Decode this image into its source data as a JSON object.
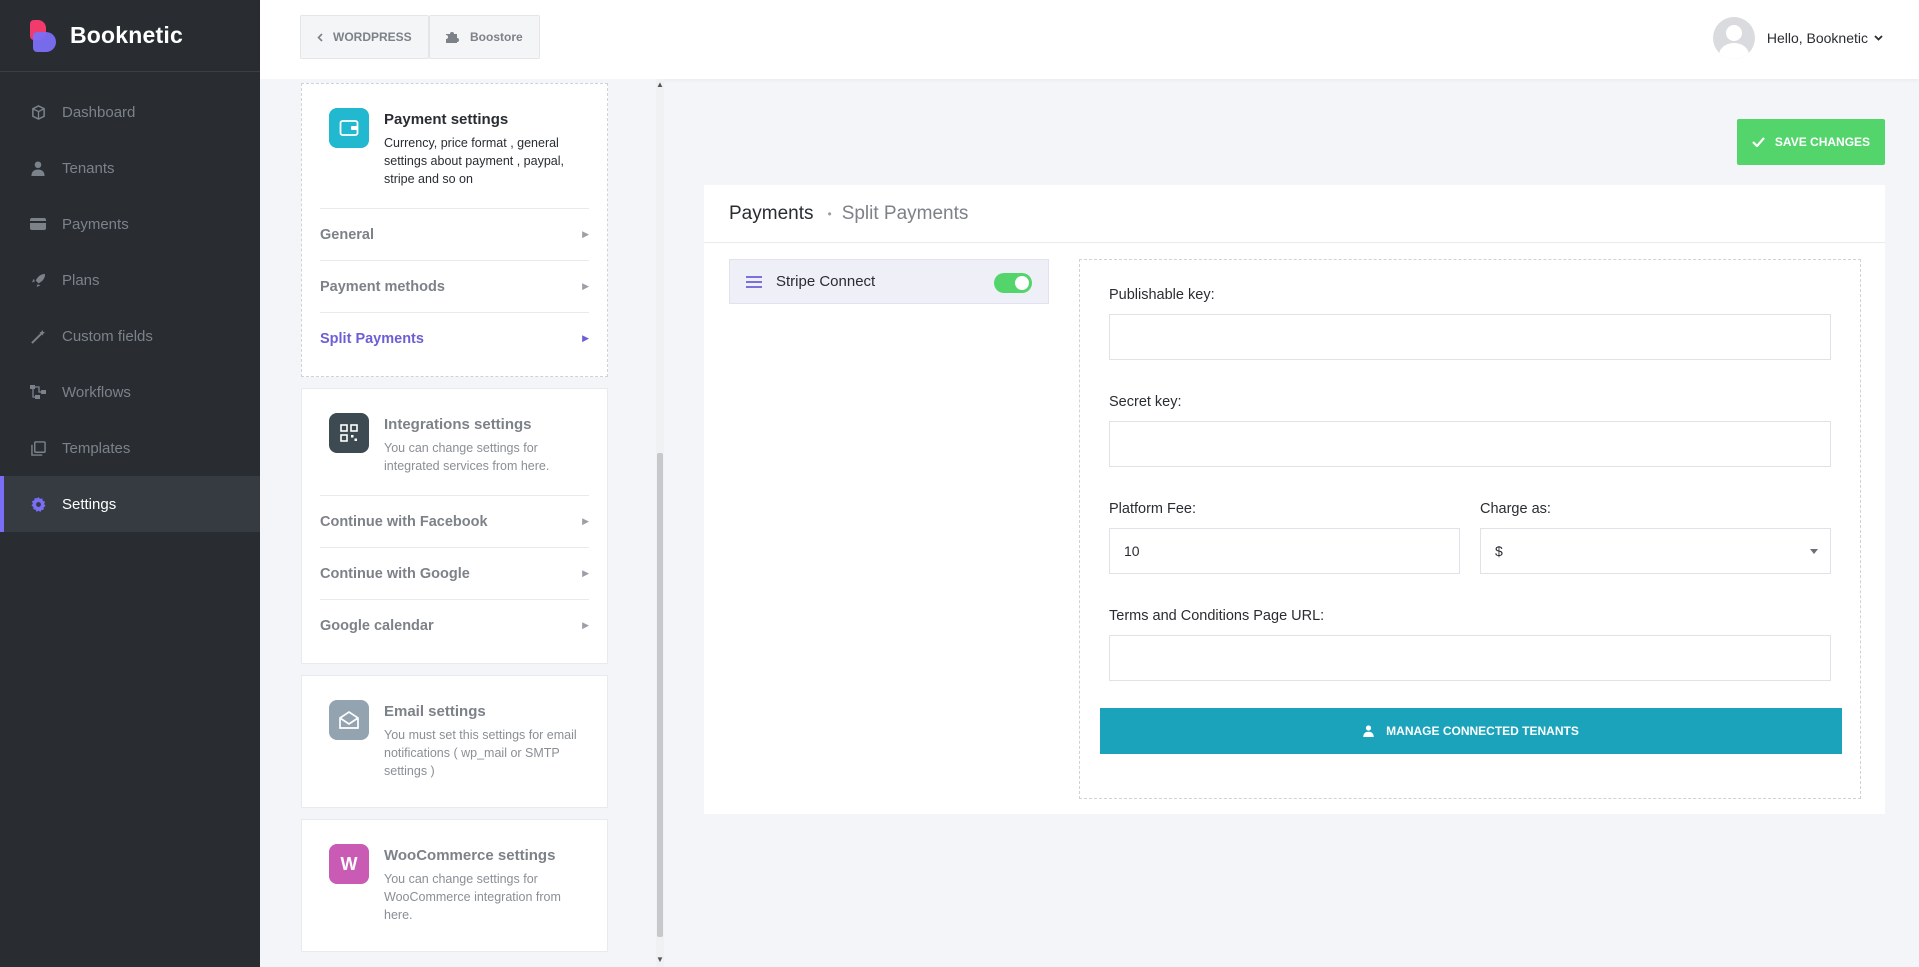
{
  "brand": {
    "name": "Booknetic"
  },
  "sidebar": {
    "items": [
      {
        "label": "Dashboard",
        "icon": "cube-icon"
      },
      {
        "label": "Tenants",
        "icon": "user-icon"
      },
      {
        "label": "Payments",
        "icon": "card-icon"
      },
      {
        "label": "Plans",
        "icon": "rocket-icon"
      },
      {
        "label": "Custom fields",
        "icon": "magic-wand-icon"
      },
      {
        "label": "Workflows",
        "icon": "workflow-icon"
      },
      {
        "label": "Templates",
        "icon": "templates-icon"
      },
      {
        "label": "Settings",
        "icon": "gear-icon",
        "active": true
      }
    ]
  },
  "topbar": {
    "wordpress_label": "WORDPRESS",
    "boostore_label": "Boostore",
    "greeting": "Hello, Booknetic"
  },
  "settings_cards": {
    "payment": {
      "title": "Payment settings",
      "desc": "Currency, price format , general settings about payment , paypal, stripe and so on",
      "items": [
        "General",
        "Payment methods",
        "Split Payments"
      ],
      "active_item": "Split Payments"
    },
    "integrations": {
      "title": "Integrations settings",
      "desc": "You can change settings for integrated services from here.",
      "items": [
        "Continue with Facebook",
        "Continue with Google",
        "Google calendar"
      ]
    },
    "email": {
      "title": "Email settings",
      "desc": "You must set this settings for email notifications ( wp_mail or SMTP settings )"
    },
    "woocommerce": {
      "title": "WooCommerce settings",
      "desc": "You can change settings for WooCommerce integration from here.",
      "logo_letter": "W"
    }
  },
  "save_button": "SAVE CHANGES",
  "main": {
    "breadcrumb": [
      "Payments",
      "Split Payments"
    ],
    "gateway": {
      "label": "Stripe Connect",
      "enabled": true
    },
    "form": {
      "publishable_key_label": "Publishable key:",
      "publishable_key_value": "",
      "secret_key_label": "Secret key:",
      "secret_key_value": "",
      "platform_fee_label": "Platform Fee:",
      "platform_fee_value": "10",
      "charge_as_label": "Charge as:",
      "charge_as_value": "$",
      "terms_label": "Terms and Conditions Page URL:",
      "terms_value": ""
    },
    "manage_button": "MANAGE CONNECTED TENANTS"
  },
  "colors": {
    "sidebar_bg": "#292d32",
    "accent": "#7b6ef6",
    "save_green": "#53d56c",
    "manage_teal": "#1aa3ba",
    "payment_icon": "#22b8cf",
    "integrations_icon": "#3d4a52",
    "email_icon": "#94a3b0",
    "woo_icon": "#c95bb4"
  }
}
